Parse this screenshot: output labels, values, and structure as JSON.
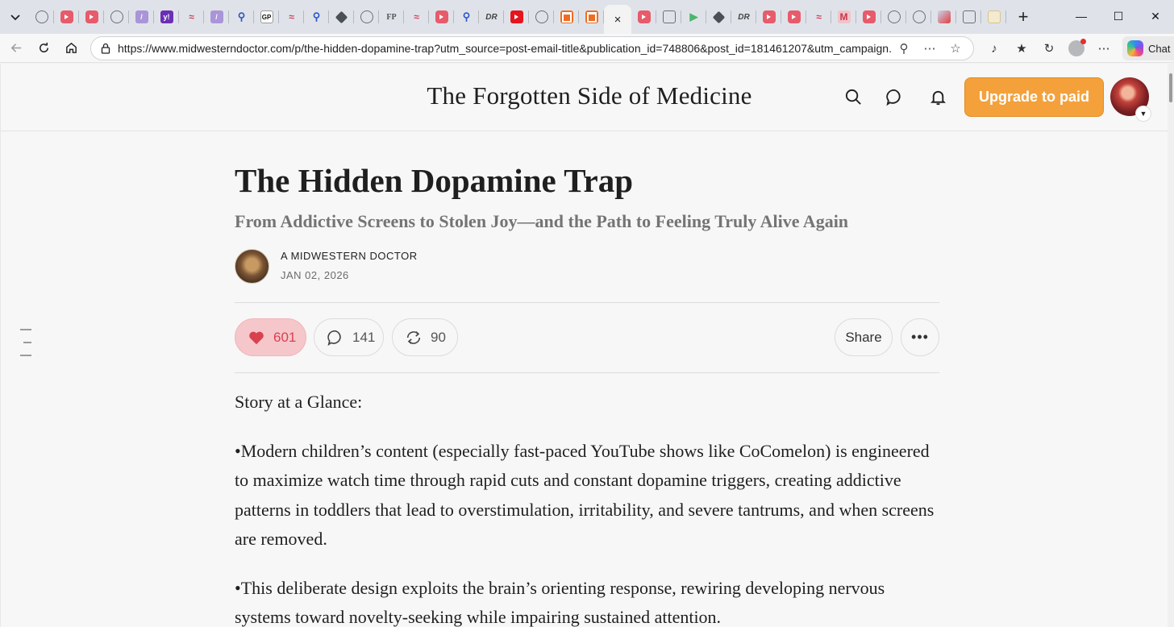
{
  "browser": {
    "tab_favicons": [
      "globe",
      "yt",
      "yt",
      "globe",
      "slash",
      "yahoo",
      "wave",
      "slash",
      "search",
      "gp",
      "wave",
      "search",
      "diamond",
      "globe",
      "fp",
      "wave",
      "yt",
      "search",
      "dr",
      "ytred",
      "globe",
      "sub",
      "sub",
      "active",
      "yt",
      "doc",
      "play",
      "diamond",
      "dr",
      "yt",
      "yt",
      "wave",
      "m",
      "yt",
      "globe",
      "globe",
      "pic",
      "doc",
      "sq"
    ],
    "active_tab_close": "×",
    "new_tab": "+",
    "url": "https://www.midwesterndoctor.com/p/the-hidden-dopamine-trap?utm_source=post-email-title&publication_id=748806&post_id=181461207&utm_campaign...",
    "chat_label": "Chat"
  },
  "site": {
    "publication_name": "The Forgotten Side of Medicine",
    "upgrade_label": "Upgrade to paid"
  },
  "article": {
    "title": "The Hidden Dopamine Trap",
    "subtitle": "From Addictive Screens to Stolen Joy—and the Path to Feeling Truly Alive Again",
    "author": "A MIDWESTERN DOCTOR",
    "date": "JAN 02, 2026",
    "likes": "601",
    "comments": "141",
    "restacks": "90",
    "share_label": "Share",
    "more_label": "•••",
    "body_heading": "Story at a Glance:",
    "paragraphs": [
      "•Modern children’s content (especially fast-paced YouTube shows like CoComelon) is engineered to maximize watch time through rapid cuts and constant dopamine triggers, creating addictive patterns in toddlers that lead to overstimulation, irritability, and severe tantrums, and when screens are removed.",
      "•This deliberate design exploits the brain’s orienting response, rewiring developing nervous systems toward novelty-seeking while impairing sustained attention."
    ]
  },
  "colors": {
    "accent": "#f4a13c",
    "like_bg": "#f5c7cb",
    "like_fg": "#d8424f"
  }
}
